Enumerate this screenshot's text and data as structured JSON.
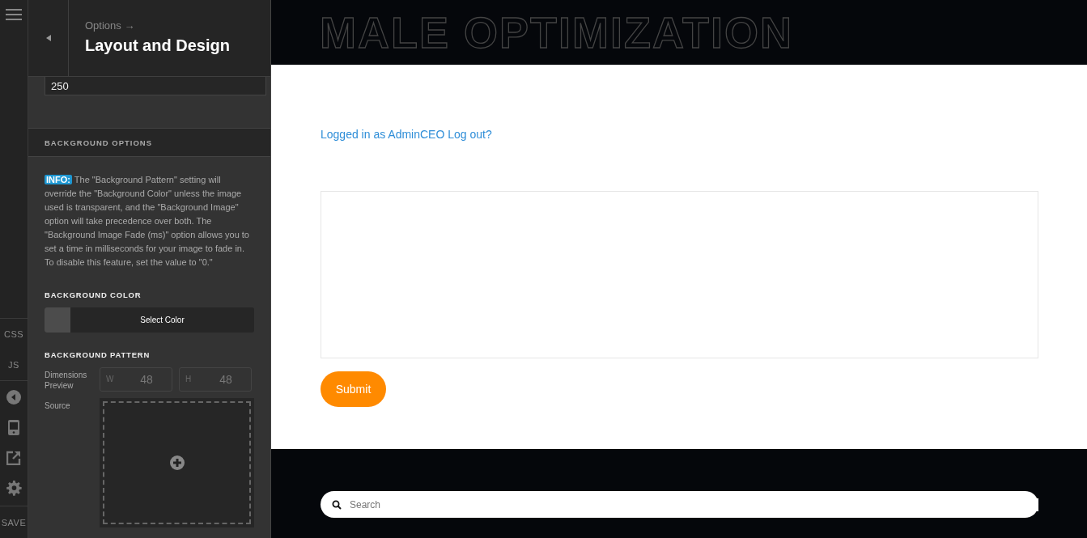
{
  "rail": {
    "items": [
      {
        "label": "CSS"
      },
      {
        "label": "JS"
      }
    ],
    "save": "SAVE"
  },
  "panel": {
    "breadcrumb": "Options →",
    "title": "Layout and Design",
    "number_field": {
      "value": "250"
    },
    "section": "BACKGROUND OPTIONS",
    "info": {
      "badge": "INFO:",
      "text": "The \"Background Pattern\" setting will override the \"Background Color\" unless the image used is transparent, and the \"Background Image\" option will take precedence over both. The \"Background Image Fade (ms)\" option allows you to set a time in milliseconds for your image to fade in. To disable this feature, set the value to \"0.\""
    },
    "background_color": {
      "label": "BACKGROUND COLOR",
      "button": "Select Color"
    },
    "background_pattern": {
      "label": "BACKGROUND PATTERN",
      "dimensions_label": "Dimensions Preview",
      "width": {
        "prefix": "W",
        "placeholder": "48"
      },
      "height": {
        "prefix": "H",
        "placeholder": "48"
      },
      "source_label": "Source"
    }
  },
  "site": {
    "logo": "MALE OPTIMIZATION",
    "login_text": "Logged in as AdminCEO",
    "logout_link": "Log out?",
    "submit": "Submit",
    "search": {
      "placeholder": "Search"
    }
  }
}
